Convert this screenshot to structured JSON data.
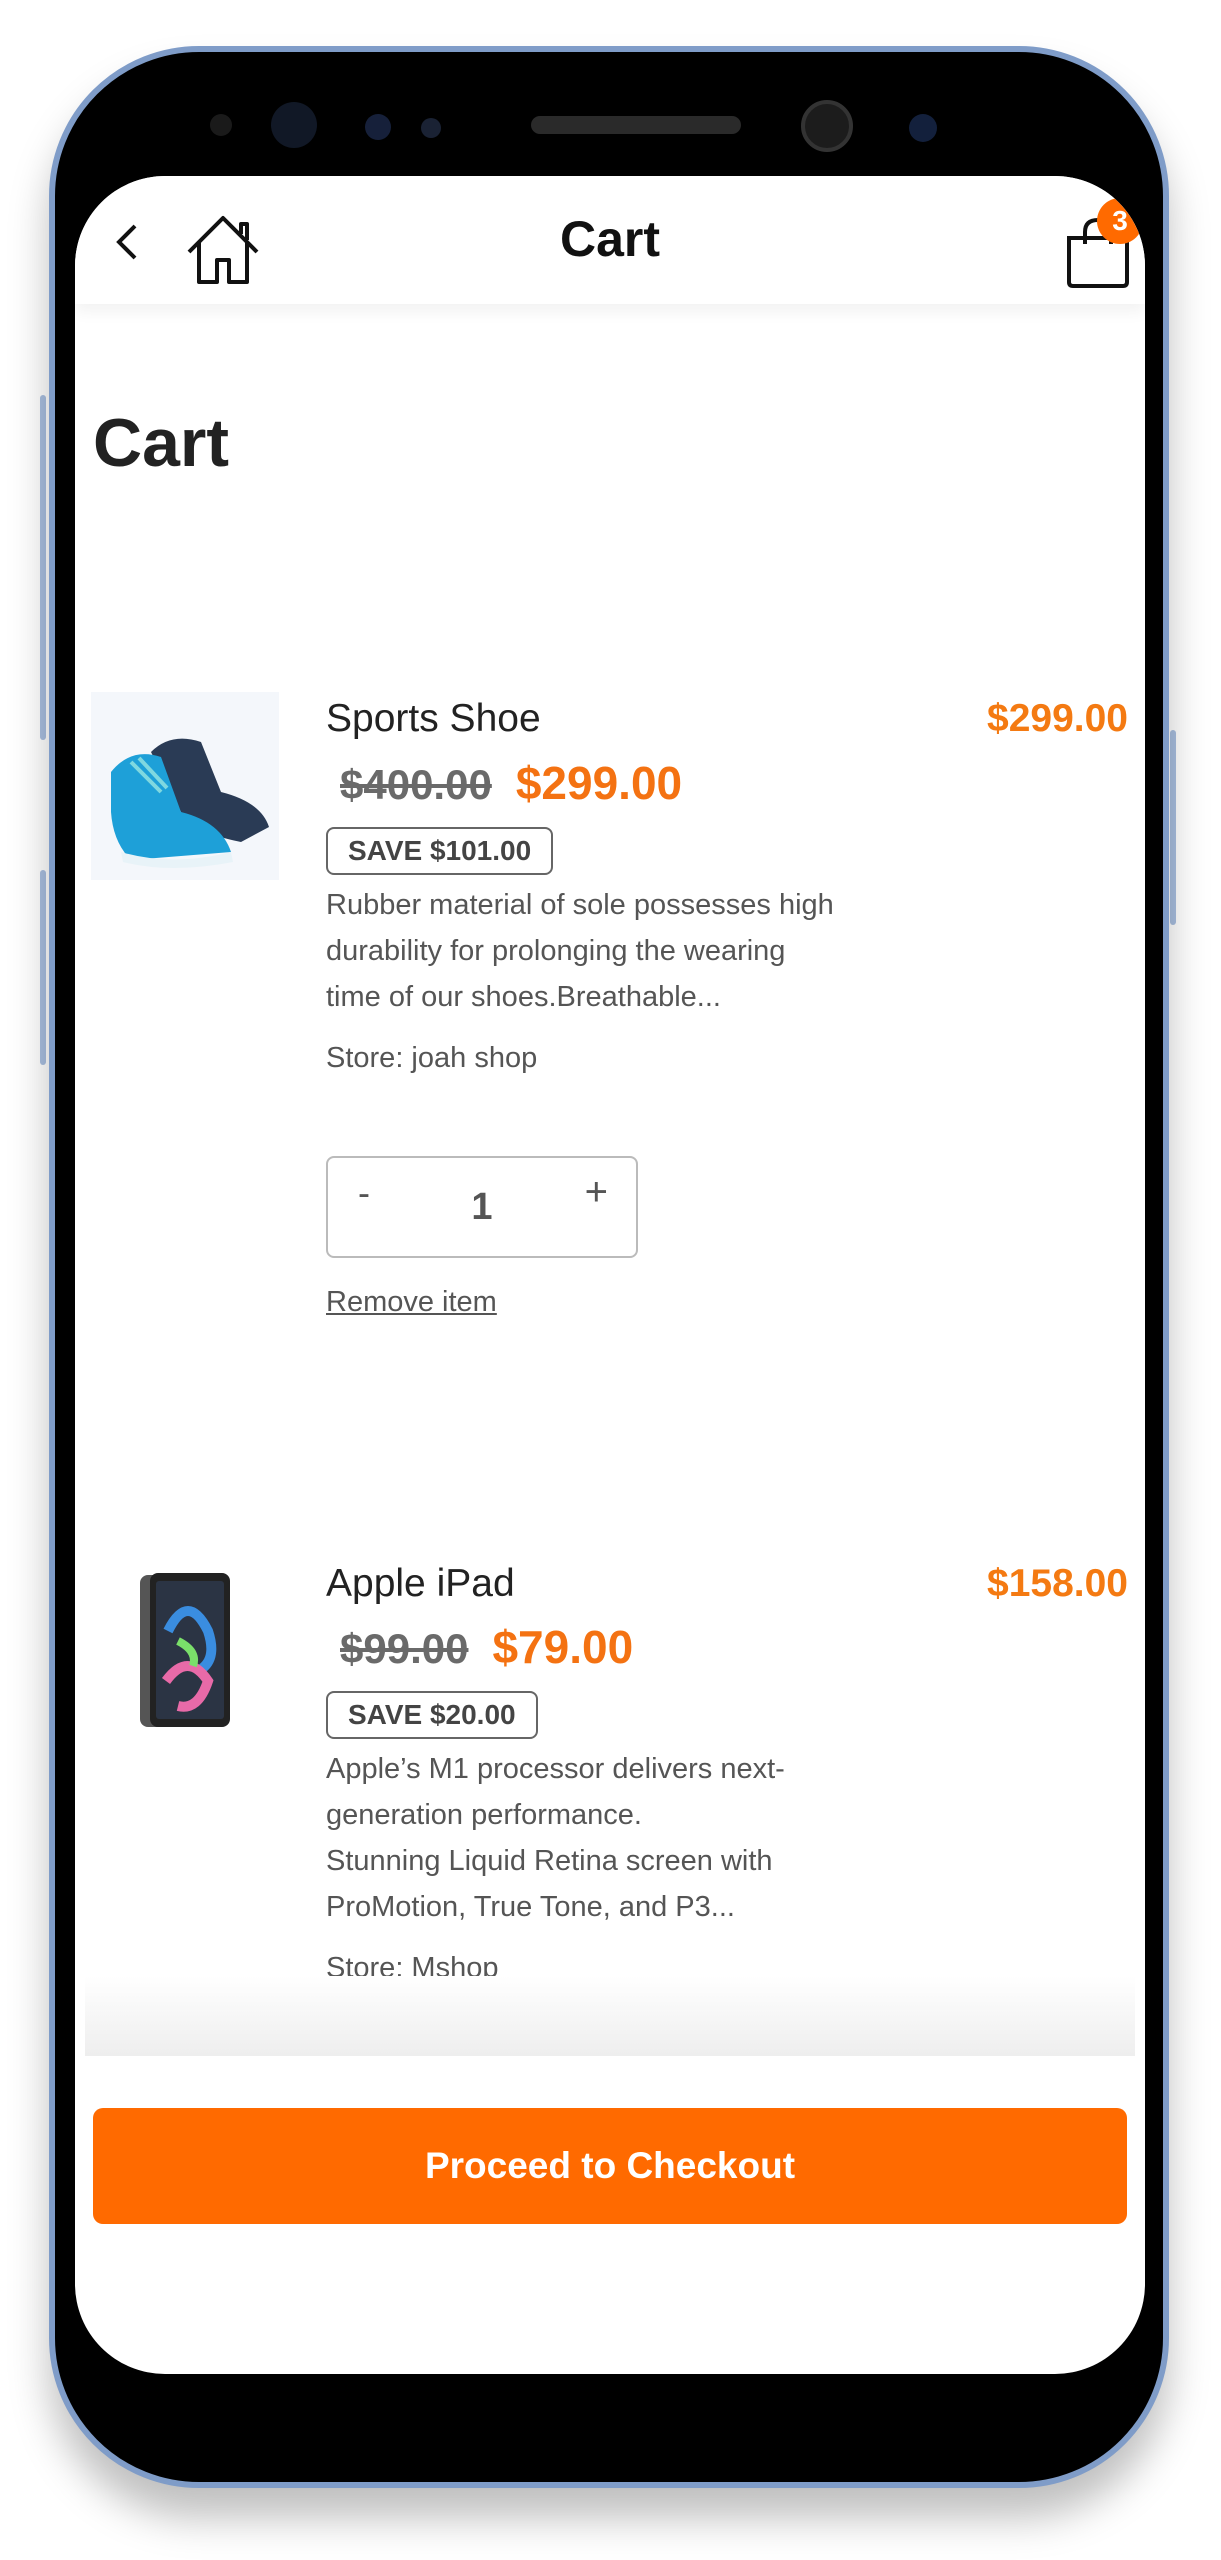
{
  "header": {
    "title": "Cart",
    "cart_badge_count": "3",
    "icons": [
      "chevron-left-icon",
      "home-icon",
      "shopping-bag-icon"
    ]
  },
  "page_title": "Cart",
  "items": [
    {
      "name": "Sports Shoe",
      "line_total": "$299.00",
      "original_price": "$400.00",
      "price": "$299.00",
      "save": "SAVE $101.00",
      "description": [
        "Rubber material of sole possesses high",
        "durability for prolonging the wearing",
        "time of our shoes.Breathable..."
      ],
      "store": "Store: joah shop",
      "quantity": "1",
      "minus": "-",
      "plus": "+",
      "remove": "Remove item"
    },
    {
      "name": "Apple iPad",
      "line_total": "$158.00",
      "original_price": "$99.00",
      "price": "$79.00",
      "save": "SAVE $20.00",
      "description": [
        "Apple’s M1 processor delivers next-",
        "generation performance.",
        "Stunning Liquid Retina screen with",
        "ProMotion, True Tone, and P3..."
      ],
      "store": "Store: Mshop"
    }
  ],
  "checkout_label": "Proceed to Checkout",
  "colors": {
    "accent": "#ff6a00",
    "price": "#f47212"
  }
}
